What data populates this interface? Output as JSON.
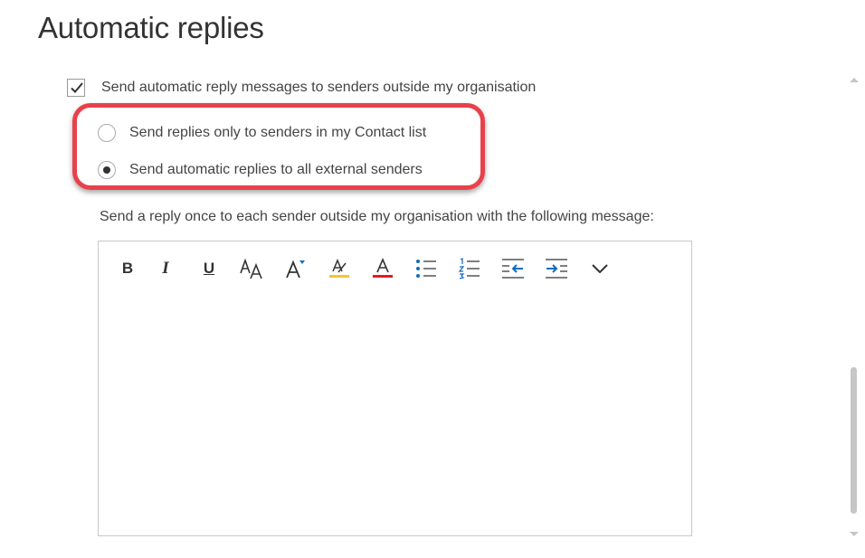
{
  "page": {
    "title": "Automatic replies"
  },
  "options": {
    "outside_checkbox": {
      "label": "Send automatic reply messages to senders outside my organisation",
      "checked": true
    },
    "radios": [
      {
        "label": "Send replies only to senders in my Contact list",
        "selected": false
      },
      {
        "label": "Send automatic replies to all external senders",
        "selected": true
      }
    ]
  },
  "message": {
    "instruction": "Send a reply once to each sender outside my organisation with the following message:",
    "body": ""
  },
  "toolbar": {
    "bold": "B",
    "italic": "I",
    "underline": "U",
    "icons": [
      "bold-icon",
      "italic-icon",
      "underline-icon",
      "font-size-icon",
      "grow-font-icon",
      "highlight-icon",
      "font-color-icon",
      "bullets-icon",
      "numbering-icon",
      "decrease-indent-icon",
      "increase-indent-icon",
      "more-options-icon"
    ]
  },
  "colors": {
    "highlight_outline": "#e8414b",
    "highlight_yellow": "#f4c430",
    "font_color_red": "#e31b23",
    "accent_blue": "#0f6cbd",
    "text": "#333333"
  }
}
